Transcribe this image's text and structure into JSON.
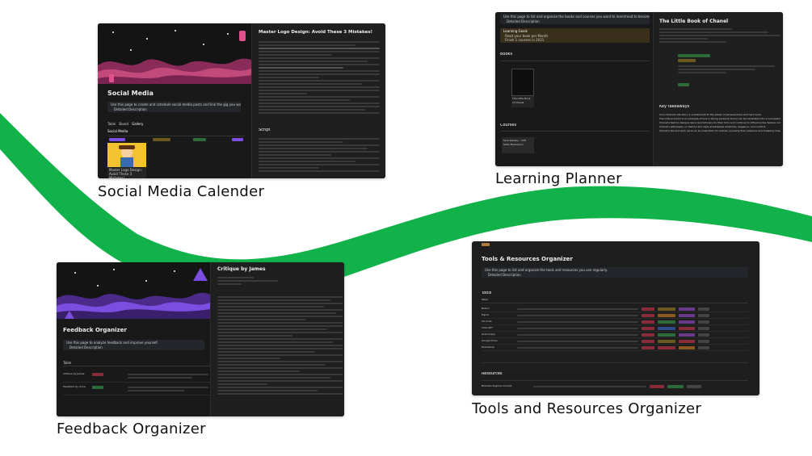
{
  "captions": {
    "social": "Social Media Calender",
    "learning": "Learning Planner",
    "feedback": "Feedback Organizer",
    "tools": "Tools and Resources Organizer"
  },
  "colors": {
    "wave": "#12b24a",
    "dark": "#191919",
    "accent_pink": "#e0508a",
    "accent_purple": "#7b4ee0",
    "accent_yellow": "#e4b03a"
  },
  "social": {
    "page_title": "Social Media",
    "hint": "Use this page to create and schedule social media posts and link the gig you want to promote.",
    "detail_link": "Detailed Description",
    "tabs": [
      "Table",
      "Board",
      "Gallery"
    ],
    "section": "Social Media",
    "card_title": "Master Logo Design: Avoid These 3 Mistakes!",
    "right_title": "Master Logo Design: Avoid These 3 Mistakes!",
    "script_heading": "Script",
    "icon": "phone-icon"
  },
  "learning": {
    "hint": "Use this page to list and organize the books and courses you want to learn/read to become a better and wealthy learner.",
    "detail_link": "Detailed Description",
    "goals_title": "Learning Goals",
    "goals_line1": "Read your book per Month",
    "goals_line2": "Finish 1 courses in 2021",
    "books_heading": "Books",
    "book_card": "The Little Book of Chanel",
    "courses_heading": "Courses",
    "course_card": "Sara Kebaby - Soft Skills Bookworm",
    "right_title": "The Little Book of Chanel",
    "key_heading": "Key takeaways",
    "takeaways": [
      "Coco Chanel's life story is a testament to the power of perseverance and hard work.",
      "The Chanel brand is an example of how a strong personal brand can be translated into a successful business.",
      "Chanel's fashion designs were revolutionary for their time and continue to influence the fashion industry today.",
      "Chanel's philosophy on fashion and style emphasizes simplicity, elegance, and comfort.",
      "Chanel's life and work serve as an inspiration for women pursuing their passions and breaking down barriers."
    ]
  },
  "feedback": {
    "page_title": "Feedback Organizer",
    "hint": "Use this page to analyze feedback and improve yourself.",
    "detail_link": "Detailed Description",
    "table_label": "Table",
    "rows": [
      "Critique by James",
      "Feedback by Anna"
    ],
    "right_title": "Critique by James",
    "icon": "warning-icon"
  },
  "tools": {
    "page_title": "Tools & Resources Organizer",
    "hint": "Use this page to list and organize the tools and resources you use regularly.",
    "detail_link": "Detailed Description",
    "tools_heading": "Tools",
    "table_label": "Table",
    "tool_names": [
      "Notion",
      "Figma",
      "VS Code",
      "Chat GPT",
      "Grammarly",
      "Google Drive",
      "Photoshop"
    ],
    "resources_heading": "Resources",
    "resource_row": "Brenden Sugmen Course",
    "icon": "hammer-icon"
  }
}
